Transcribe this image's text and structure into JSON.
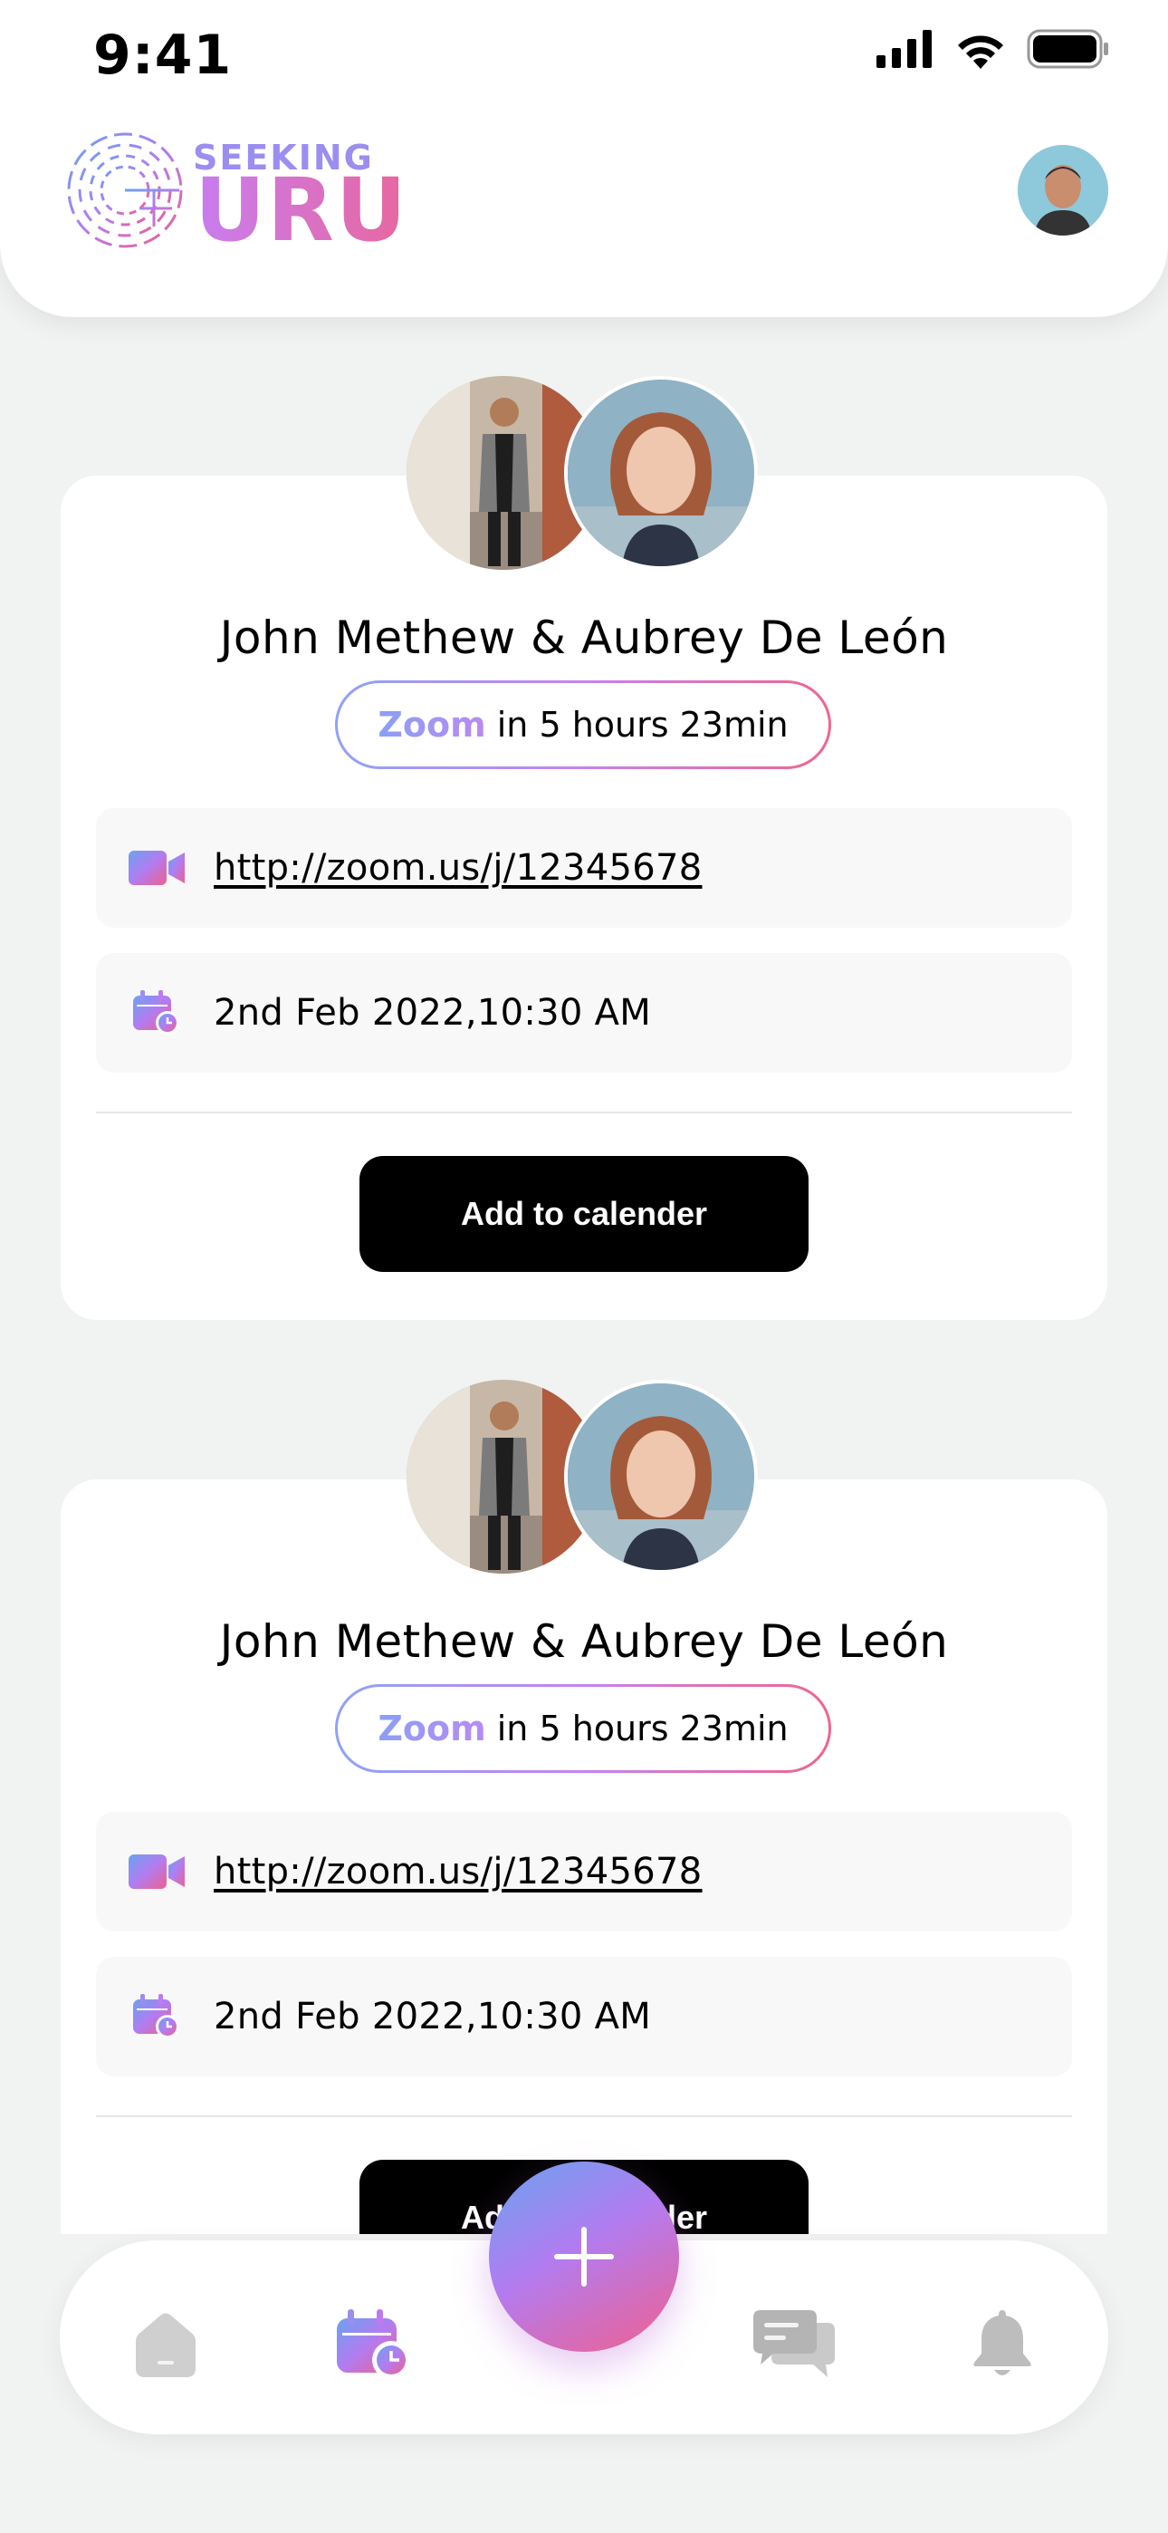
{
  "status_bar": {
    "time": "9:41"
  },
  "header": {
    "logo_small": "SEEKING",
    "logo_large": "URU",
    "avatar_icon": "user-avatar"
  },
  "meetings": [
    {
      "names": "John Methew & Aubrey De León",
      "platform": "Zoom",
      "countdown": "in 5 hours 23min",
      "link": "http://zoom.us/j/12345678",
      "datetime": "2nd Feb 2022,10:30 AM",
      "button_label": "Add to calender"
    },
    {
      "names": "John Methew & Aubrey De León",
      "platform": "Zoom",
      "countdown": "in 5 hours 23min",
      "link": "http://zoom.us/j/12345678",
      "datetime": "2nd Feb 2022,10:30 AM",
      "button_label": "Add to calender"
    }
  ],
  "bottom_nav": {
    "items": [
      "home-icon",
      "calendar-icon",
      "chat-icon",
      "bell-icon"
    ],
    "active": "calendar-icon",
    "fab_icon": "plus-icon"
  },
  "colors": {
    "accent_gradient_start": "#6aa3f0",
    "accent_gradient_mid": "#b27cf0",
    "accent_gradient_end": "#f0608e",
    "button": "#000000",
    "background": "#f1f2f2"
  }
}
